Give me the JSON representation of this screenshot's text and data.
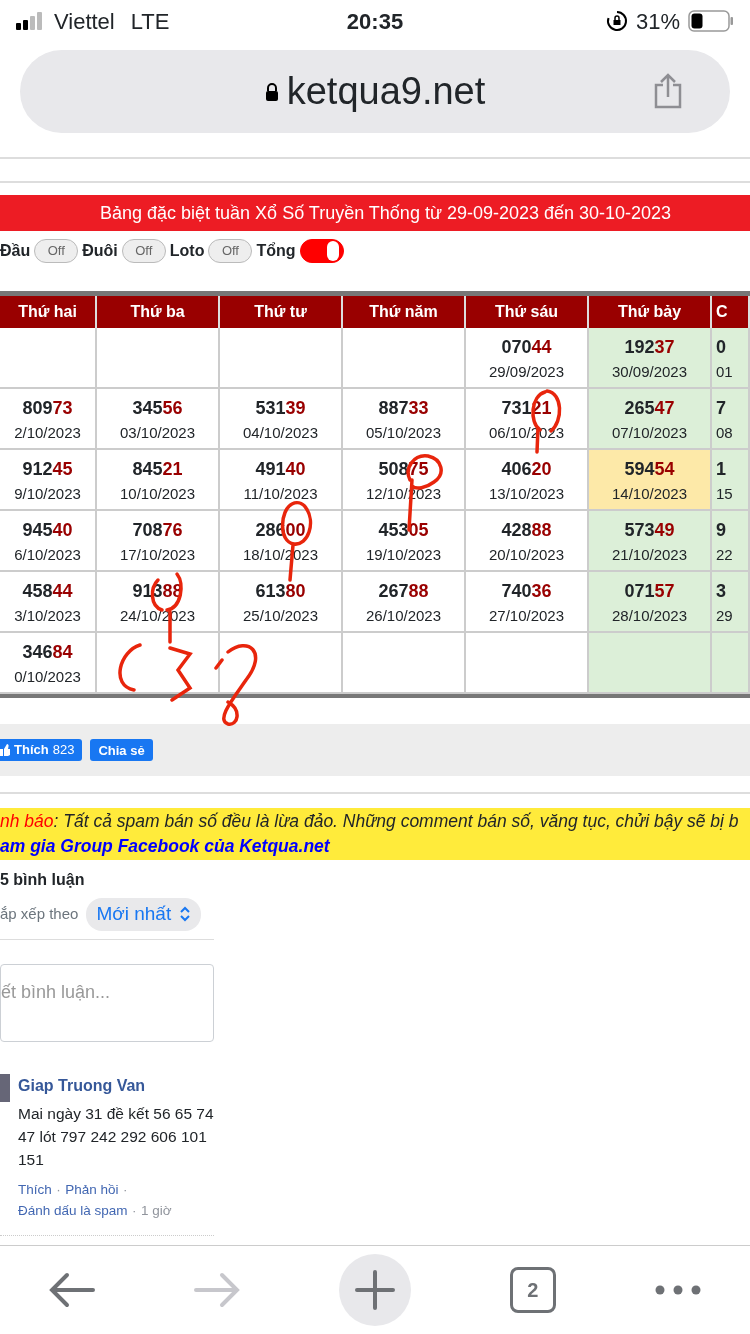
{
  "status_bar": {
    "carrier": "Viettel",
    "network": "LTE",
    "time": "20:35",
    "battery": "31%"
  },
  "address_bar": {
    "url": "ketqua9.net"
  },
  "banner": {
    "title": "Bảng đặc biệt tuần Xổ Số Truyền Thống từ 29-09-2023 đến 30-10-2023"
  },
  "toggles": [
    {
      "label": "Đầu",
      "on": false,
      "switch_text": "Off"
    },
    {
      "label": "Đuôi",
      "on": false,
      "switch_text": "Off"
    },
    {
      "label": "Loto",
      "on": false,
      "switch_text": "Off"
    },
    {
      "label": "Tổng",
      "on": true
    }
  ],
  "table": {
    "columns": [
      "Thứ hai",
      "Thứ ba",
      "Thứ tư",
      "Thứ năm",
      "Thứ sáu",
      "Thứ bảy",
      "C"
    ],
    "rows": [
      [
        {
          "kind": "normal"
        },
        {
          "kind": "normal"
        },
        {
          "kind": "normal"
        },
        {
          "kind": "normal"
        },
        {
          "kind": "normal",
          "head": "070",
          "tail": "44",
          "date": "29/09/2023"
        },
        {
          "kind": "weekend",
          "head": "192",
          "tail": "37",
          "date": "30/09/2023"
        },
        {
          "kind": "weekend",
          "head": "0",
          "date": "01"
        }
      ],
      [
        {
          "kind": "normal",
          "head": "809",
          "tail": "73",
          "date": "2/10/2023"
        },
        {
          "kind": "normal",
          "head": "345",
          "tail": "56",
          "date": "03/10/2023"
        },
        {
          "kind": "normal",
          "head": "531",
          "tail": "39",
          "date": "04/10/2023"
        },
        {
          "kind": "normal",
          "head": "887",
          "tail": "33",
          "date": "05/10/2023"
        },
        {
          "kind": "normal",
          "head": "731",
          "tail": "21",
          "date": "06/10/2023"
        },
        {
          "kind": "weekend",
          "head": "265",
          "tail": "47",
          "date": "07/10/2023"
        },
        {
          "kind": "weekend",
          "head": "7",
          "date": "08"
        }
      ],
      [
        {
          "kind": "normal",
          "head": "912",
          "tail": "45",
          "date": "9/10/2023"
        },
        {
          "kind": "normal",
          "head": "845",
          "tail": "21",
          "date": "10/10/2023"
        },
        {
          "kind": "normal",
          "head": "491",
          "tail": "40",
          "date": "11/10/2023"
        },
        {
          "kind": "normal",
          "head": "508",
          "tail": "75",
          "date": "12/10/2023"
        },
        {
          "kind": "normal",
          "head": "406",
          "tail": "20",
          "date": "13/10/2023"
        },
        {
          "kind": "highlight",
          "head": "594",
          "tail": "54",
          "date": "14/10/2023"
        },
        {
          "kind": "weekend",
          "head": "1",
          "date": "15"
        }
      ],
      [
        {
          "kind": "normal",
          "head": "945",
          "tail": "40",
          "date": "6/10/2023"
        },
        {
          "kind": "normal",
          "head": "708",
          "tail": "76",
          "date": "17/10/2023"
        },
        {
          "kind": "normal",
          "head": "286",
          "tail": "00",
          "date": "18/10/2023"
        },
        {
          "kind": "normal",
          "head": "453",
          "tail": "05",
          "date": "19/10/2023"
        },
        {
          "kind": "normal",
          "head": "428",
          "tail": "88",
          "date": "20/10/2023"
        },
        {
          "kind": "weekend",
          "head": "573",
          "tail": "49",
          "date": "21/10/2023"
        },
        {
          "kind": "weekend",
          "head": "9",
          "date": "22"
        }
      ],
      [
        {
          "kind": "normal",
          "head": "458",
          "tail": "44",
          "date": "3/10/2023"
        },
        {
          "kind": "normal",
          "head": "913",
          "tail": "88",
          "date": "24/10/2023"
        },
        {
          "kind": "normal",
          "head": "613",
          "tail": "80",
          "date": "25/10/2023"
        },
        {
          "kind": "normal",
          "head": "267",
          "tail": "88",
          "date": "26/10/2023"
        },
        {
          "kind": "normal",
          "head": "740",
          "tail": "36",
          "date": "27/10/2023"
        },
        {
          "kind": "weekend",
          "head": "071",
          "tail": "57",
          "date": "28/10/2023"
        },
        {
          "kind": "weekend",
          "head": "3",
          "date": "29"
        }
      ],
      [
        {
          "kind": "normal",
          "head": "346",
          "tail": "84",
          "date": "0/10/2023"
        },
        {
          "kind": "normal"
        },
        {
          "kind": "normal"
        },
        {
          "kind": "normal"
        },
        {
          "kind": "normal"
        },
        {
          "kind": "weekend"
        },
        {
          "kind": "weekend"
        }
      ]
    ]
  },
  "social": {
    "like_label": "Thích",
    "like_count": "823",
    "share_label": "Chia sẻ"
  },
  "warning": {
    "label": "nh báo",
    "text": ": Tất cả spam bán số đều là lừa đảo. Những comment bán số, văng tục, chửi bậy sẽ bị b",
    "link": "am gia Group Facebook của Ketqua.net"
  },
  "comments": {
    "count": "5 bình luận",
    "sort_label": "ắp xếp theo",
    "sort_value": "Mới nhất",
    "placeholder": "ết bình luận...",
    "items": [
      {
        "author": "Giap Truong Van",
        "text": "Mai ngày 31 đề kết 56 65 74 47 lót 797 242 292 606 101 151",
        "actions": [
          "Thích",
          "Phản hồi",
          "Đánh dấu là spam"
        ],
        "separator": "·",
        "time": "1 giờ"
      }
    ]
  },
  "toolbar": {
    "tab_count": "2",
    "forward_disabled": true
  }
}
